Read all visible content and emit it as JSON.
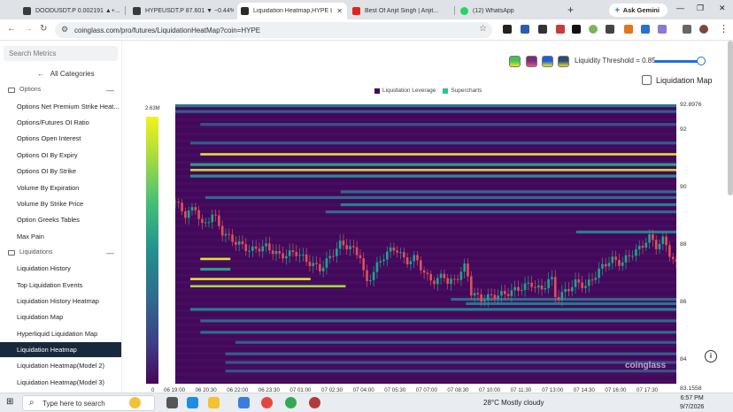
{
  "browser": {
    "tabs": [
      {
        "title": "DOODUSDT.P 0.002191 ▲+...",
        "active": false,
        "favicon_color": "#3a3a3a"
      },
      {
        "title": "HYPEUSDT.P 87.601 ▼ −0.44%",
        "active": false,
        "favicon_color": "#3a3a3a"
      },
      {
        "title": "Liquidation Heatmap,HYPE Li...",
        "active": true,
        "favicon_color": "#2a2a2a"
      },
      {
        "title": "Best Of Arijit Singh | Arijit...",
        "active": false,
        "favicon_color": "#e62117"
      },
      {
        "title": "(12) WhatsApp",
        "active": false,
        "favicon_color": "#25d366"
      }
    ],
    "new_tab_icon": "plus-icon",
    "gemini_label": "Ask Gemini",
    "url": "coinglass.com/pro/futures/LiquidationHeatMap?coin=HYPE"
  },
  "sidebar": {
    "search_placeholder": "Search Metrics",
    "all_categories": "All Categories",
    "sections": [
      {
        "title": "Options",
        "items": [
          "Options Net Premium Strike Heat...",
          "Options/Futures OI Ratio",
          "Options Open Interest",
          "Options OI By Expiry",
          "Options OI By Strike",
          "Volume By Expiration",
          "Volume By Strike Price",
          "Option Greeks Tables",
          "Max Pain"
        ]
      },
      {
        "title": "Liquidations",
        "items": [
          "Liquidation History",
          "Top Liquidation Events",
          "Liquidation History Heatmap",
          "Liquidation Map",
          "Hyperliquid Liquidation Map",
          "Liquidation Heatmap",
          "Liquidation Heatmap(Model 2)",
          "Liquidation Heatmap(Model 3)"
        ]
      }
    ],
    "active_item": "Liquidation Heatmap"
  },
  "controls": {
    "swatch_colors": [
      [
        "#3ec35b",
        "#f2e51d"
      ],
      [
        "#7a2d7b",
        "#e05a7a"
      ],
      [
        "#1b5fd6",
        "#f0e91a"
      ],
      [
        "#2c4a7a",
        "#e8e020"
      ]
    ],
    "threshold_label": "Liquidity Threshold = 0.85",
    "threshold_value": 0.85,
    "liquidation_map_label": "Liquidation Map",
    "liquidation_map_checked": false
  },
  "legend": [
    {
      "label": "Liquidation Leverage",
      "color": "#44075a"
    },
    {
      "label": "Supercharts",
      "color": "#2fc48d"
    }
  ],
  "colorbar": {
    "max": "2.63M",
    "min": "0"
  },
  "chart_data": {
    "type": "heatmap",
    "title": "",
    "price_axis_labels": [
      "92.8976",
      "92",
      "90",
      "88",
      "86",
      "84",
      "83.1558"
    ],
    "y_range": [
      83.1558,
      92.8976
    ],
    "y_ticks": [
      92,
      90,
      88,
      86,
      84
    ],
    "time_labels": [
      "06 19:00",
      "06 20:30",
      "06 22:00",
      "06 23:30",
      "07 01:00",
      "07 02:30",
      "07 04:00",
      "07 05:30",
      "07 07:00",
      "07 08:30",
      "07 10:00",
      "07 11:30",
      "07 13:00",
      "07 14:30",
      "07 16:00",
      "07 17:30"
    ],
    "background_color": "#44085a",
    "liquidity_bands": [
      {
        "price": 92.85,
        "t_start": 0.0,
        "t_end": 1.0,
        "level": 0.45
      },
      {
        "price": 92.65,
        "t_start": 0.0,
        "t_end": 1.0,
        "level": 0.35
      },
      {
        "price": 92.2,
        "t_start": 0.05,
        "t_end": 1.0,
        "level": 0.3
      },
      {
        "price": 91.55,
        "t_start": 0.03,
        "t_end": 1.0,
        "level": 0.35
      },
      {
        "price": 91.15,
        "t_start": 0.05,
        "t_end": 1.0,
        "level": 0.95
      },
      {
        "price": 90.8,
        "t_start": 0.03,
        "t_end": 1.0,
        "level": 0.6
      },
      {
        "price": 90.6,
        "t_start": 0.03,
        "t_end": 1.0,
        "level": 0.9
      },
      {
        "price": 90.4,
        "t_start": 0.03,
        "t_end": 1.0,
        "level": 0.55
      },
      {
        "price": 89.85,
        "t_start": 0.33,
        "t_end": 1.0,
        "level": 0.4
      },
      {
        "price": 89.65,
        "t_start": 0.06,
        "t_end": 1.0,
        "level": 0.4
      },
      {
        "price": 89.4,
        "t_start": 0.33,
        "t_end": 1.0,
        "level": 0.5
      },
      {
        "price": 89.15,
        "t_start": 0.3,
        "t_end": 1.0,
        "level": 0.4
      },
      {
        "price": 88.45,
        "t_start": 0.8,
        "t_end": 1.0,
        "level": 0.5
      },
      {
        "price": 87.5,
        "t_start": 0.05,
        "t_end": 0.11,
        "level": 0.95
      },
      {
        "price": 87.15,
        "t_start": 0.05,
        "t_end": 0.11,
        "level": 0.6
      },
      {
        "price": 86.8,
        "t_start": 0.03,
        "t_end": 0.27,
        "level": 0.95
      },
      {
        "price": 86.55,
        "t_start": 0.03,
        "t_end": 0.34,
        "level": 0.85
      },
      {
        "price": 86.1,
        "t_start": 0.55,
        "t_end": 1.0,
        "level": 0.4
      },
      {
        "price": 85.95,
        "t_start": 0.58,
        "t_end": 1.0,
        "level": 0.45
      },
      {
        "price": 85.75,
        "t_start": 0.03,
        "t_end": 1.0,
        "level": 0.5
      },
      {
        "price": 85.35,
        "t_start": 0.05,
        "t_end": 1.0,
        "level": 0.4
      },
      {
        "price": 84.95,
        "t_start": 0.05,
        "t_end": 1.0,
        "level": 0.4
      },
      {
        "price": 84.6,
        "t_start": 0.12,
        "t_end": 1.0,
        "level": 0.35
      },
      {
        "price": 84.2,
        "t_start": 0.1,
        "t_end": 1.0,
        "level": 0.35
      },
      {
        "price": 83.9,
        "t_start": 0.1,
        "t_end": 1.0,
        "level": 0.3
      },
      {
        "price": 83.6,
        "t_start": 0.1,
        "t_end": 1.0,
        "level": 0.3
      }
    ],
    "price_series": [
      {
        "t": 0.0,
        "p": 89.5
      },
      {
        "t": 0.02,
        "p": 89.05
      },
      {
        "t": 0.04,
        "p": 89.3
      },
      {
        "t": 0.055,
        "p": 88.6
      },
      {
        "t": 0.075,
        "p": 89.1
      },
      {
        "t": 0.095,
        "p": 88.4
      },
      {
        "t": 0.12,
        "p": 88.1
      },
      {
        "t": 0.15,
        "p": 87.8
      },
      {
        "t": 0.18,
        "p": 87.95
      },
      {
        "t": 0.21,
        "p": 87.6
      },
      {
        "t": 0.24,
        "p": 87.75
      },
      {
        "t": 0.265,
        "p": 87.4
      },
      {
        "t": 0.29,
        "p": 87.15
      },
      {
        "t": 0.31,
        "p": 87.6
      },
      {
        "t": 0.33,
        "p": 88.05
      },
      {
        "t": 0.35,
        "p": 87.9
      },
      {
        "t": 0.37,
        "p": 87.6
      },
      {
        "t": 0.38,
        "p": 86.6
      },
      {
        "t": 0.4,
        "p": 87.2
      },
      {
        "t": 0.42,
        "p": 87.7
      },
      {
        "t": 0.44,
        "p": 87.9
      },
      {
        "t": 0.46,
        "p": 87.4
      },
      {
        "t": 0.48,
        "p": 87.55
      },
      {
        "t": 0.5,
        "p": 86.9
      },
      {
        "t": 0.52,
        "p": 86.7
      },
      {
        "t": 0.535,
        "p": 87.0
      },
      {
        "t": 0.545,
        "p": 86.65
      },
      {
        "t": 0.56,
        "p": 86.8
      },
      {
        "t": 0.58,
        "p": 87.3
      },
      {
        "t": 0.59,
        "p": 86.35
      },
      {
        "t": 0.61,
        "p": 86.1
      },
      {
        "t": 0.63,
        "p": 86.2
      },
      {
        "t": 0.66,
        "p": 86.3
      },
      {
        "t": 0.69,
        "p": 86.5
      },
      {
        "t": 0.71,
        "p": 86.65
      },
      {
        "t": 0.73,
        "p": 86.4
      },
      {
        "t": 0.75,
        "p": 86.9
      },
      {
        "t": 0.76,
        "p": 86.1
      },
      {
        "t": 0.78,
        "p": 86.4
      },
      {
        "t": 0.8,
        "p": 86.7
      },
      {
        "t": 0.82,
        "p": 86.55
      },
      {
        "t": 0.85,
        "p": 87.2
      },
      {
        "t": 0.87,
        "p": 87.5
      },
      {
        "t": 0.89,
        "p": 87.35
      },
      {
        "t": 0.91,
        "p": 87.7
      },
      {
        "t": 0.93,
        "p": 87.9
      },
      {
        "t": 0.945,
        "p": 88.3
      },
      {
        "t": 0.96,
        "p": 87.95
      },
      {
        "t": 0.975,
        "p": 88.2
      },
      {
        "t": 0.99,
        "p": 87.55
      },
      {
        "t": 1.0,
        "p": 87.3
      }
    ],
    "up_color": "#1ea58c",
    "down_color": "#e0505a",
    "watermark": "coinglass"
  },
  "taskbar": {
    "search_placeholder": "Type here to search",
    "weather": "28°C  Mostly cloudy",
    "time": "6:57 PM",
    "date": "9/7/2026"
  }
}
